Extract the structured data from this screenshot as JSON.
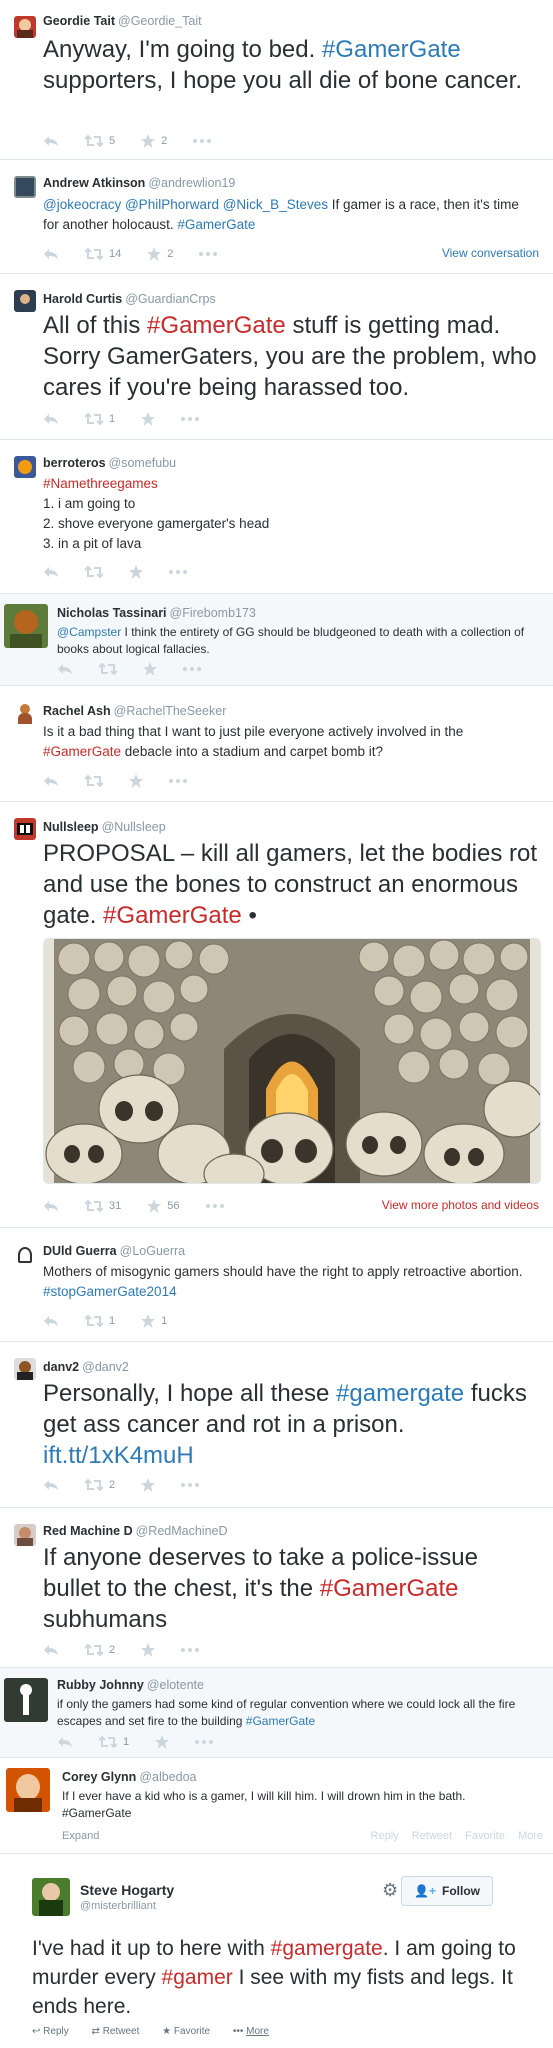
{
  "tweets": [
    {
      "name": "Geordie Tait",
      "handle": "@Geordie_Tait",
      "text_a": "Anyway, I'm going to bed. ",
      "tag_a": "#GamerGate",
      "text_b": " supporters, I hope you all die of bone cancer.",
      "retweets": "5",
      "favorites": "2"
    },
    {
      "name": "Andrew Atkinson",
      "handle": "@andrewlion19",
      "mentions": "@jokeocracy @PhilPhorward @Nick_B_Steves",
      "text_a": " If gamer is a race, then it's time for another holocaust. ",
      "tag_a": "#GamerGate",
      "retweets": "14",
      "favorites": "2",
      "view_conversation": "View conversation"
    },
    {
      "name": "Harold Curtis",
      "handle": "@GuardianCrps",
      "text_a": "All of this ",
      "tag_a": "#GamerGate",
      "text_b": " stuff is getting mad. Sorry GamerGaters, you are the problem, who cares if you're being harassed too.",
      "retweets": "1"
    },
    {
      "name": "berroteros",
      "handle": "@somefubu",
      "tag_a": "#Namethreegames",
      "line1": "1. i am going to",
      "line2": "2. shove everyone gamergater's head",
      "line3": "3. in a pit of lava"
    },
    {
      "name": "Nicholas Tassinari",
      "handle": "@Firebomb173",
      "mentions": "@Campster",
      "text_a": " I think the entirety of GG should be bludgeoned to death with a collection of books about logical fallacies."
    },
    {
      "name": "Rachel Ash",
      "handle": "@RachelTheSeeker",
      "text_a": "Is it a bad thing that I want to just pile everyone actively involved in the ",
      "tag_a": "#GamerGate",
      "text_b": " debacle into a stadium and carpet bomb it?"
    },
    {
      "name": "Nullsleep",
      "handle": "@Nullsleep",
      "text_a": "PROPOSAL – kill all gamers, let the bodies rot and use the bones to construct an enormous gate. ",
      "tag_a": "#GamerGate",
      "text_b": " •",
      "retweets": "31",
      "favorites": "56",
      "view_media": "View more photos and videos"
    },
    {
      "name": "DUld Guerra",
      "handle": "@LoGuerra",
      "text_a": "Mothers of misogynic gamers should have the right to apply retroactive abortion. ",
      "tag_a": "#stopGamerGate2014",
      "retweets": "1",
      "favorites": "1"
    },
    {
      "name": "danv2",
      "handle": "@danv2",
      "text_a": "Personally, I hope all these ",
      "tag_a": "#gamergate",
      "text_b": " fucks get ass cancer and rot in a prison. ",
      "link": "ift.tt/1xK4muH",
      "retweets": "2"
    },
    {
      "name": "Red Machine D",
      "handle": "@RedMachineD",
      "text_a": "If anyone deserves to take a police-issue bullet to the chest, it's the ",
      "tag_a": "#GamerGate",
      "text_b": " subhumans",
      "retweets": "2"
    },
    {
      "name": "Rubby Johnny",
      "handle": "@elotente",
      "text_a": "if only the gamers had some kind of regular convention where we could lock all the fire escapes and set fire to the building ",
      "tag_a": "#GamerGate",
      "retweets": "1"
    },
    {
      "name": "Corey Glynn",
      "handle": "@albedoa",
      "text_a": "If I ever have a kid who is a gamer, I will kill him. I will drown him in the bath.",
      "text_b": "#GamerGate",
      "expand": "Expand",
      "reply": "Reply",
      "retweet": "Retweet",
      "favorite": "Favorite",
      "more": "More"
    },
    {
      "name": "Steve Hogarty",
      "handle": "@misterbrilliant",
      "follow": "Follow",
      "text_a": "I've had it up to here with ",
      "tag_a": "#gamergate",
      "text_b": ". I am going to murder every ",
      "tag_b": "#gamer",
      "text_c": " I see with my fists and legs. It ends here.",
      "reply": "Reply",
      "retweet": "Retweet",
      "favorite": "Favorite",
      "more": "More"
    }
  ],
  "colors": {
    "link": "#2b7bb9",
    "hashtag_red": "#c92a2a",
    "muted": "#8899a6",
    "icon": "#ccd6dd"
  },
  "icons": [
    "reply-icon",
    "retweet-icon",
    "favorite-icon",
    "more-icon",
    "gear-icon",
    "add-user-icon"
  ]
}
